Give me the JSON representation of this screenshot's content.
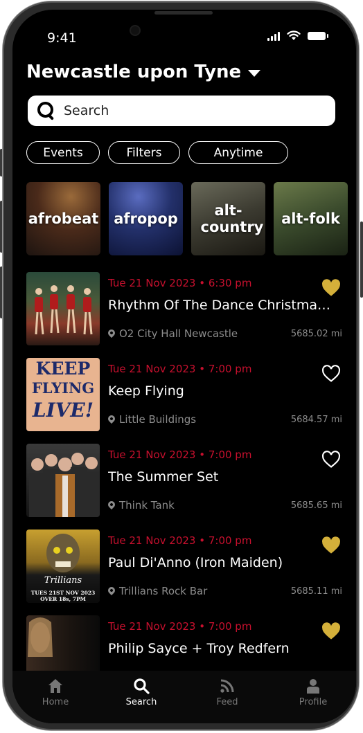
{
  "status": {
    "time": "9:41"
  },
  "location": {
    "city": "Newcastle upon Tyne"
  },
  "search": {
    "placeholder": "Search"
  },
  "filters": [
    "Events",
    "Filters",
    "Anytime"
  ],
  "genres": [
    "afrobeat",
    "afropop",
    "alt-country",
    "alt-folk"
  ],
  "events": [
    {
      "date": "Tue 21 Nov 2023 • 6:30 pm",
      "title": "Rhythm Of The Dance Christmas ...",
      "venue": "O2 City Hall Newcastle",
      "distance": "5685.02 mi",
      "favorited": true
    },
    {
      "date": "Tue 21 Nov 2023 • 7:00 pm",
      "title": "Keep Flying",
      "venue": "Little Buildings",
      "distance": "5684.57 mi",
      "favorited": false
    },
    {
      "date": "Tue 21 Nov 2023 • 7:00 pm",
      "title": "The Summer Set",
      "venue": "Think Tank",
      "distance": "5685.65 mi",
      "favorited": false
    },
    {
      "date": "Tue 21 Nov 2023 • 7:00 pm",
      "title": "Paul Di'Anno (Iron Maiden)",
      "venue": "Trillians Rock Bar",
      "distance": "5685.11 mi",
      "favorited": true
    },
    {
      "date": "Tue 21 Nov 2023 • 7:00 pm",
      "title": "Philip Sayce + Troy Redfern",
      "venue": "",
      "distance": "",
      "favorited": true
    }
  ],
  "tabs": [
    {
      "label": "Home",
      "icon": "home-icon",
      "active": false
    },
    {
      "label": "Search",
      "icon": "search-icon",
      "active": true
    },
    {
      "label": "Feed",
      "icon": "rss-feed-icon",
      "active": false
    },
    {
      "label": "Profile",
      "icon": "person-icon",
      "active": false
    }
  ],
  "colors": {
    "accent_date": "#c8102e",
    "heart_filled": "#d4b03a",
    "background": "#000000"
  },
  "thumbnails": {
    "event_1": "Keep Flying Live poster text",
    "event_1_text": [
      "KEEP",
      "FLYING",
      "LIVE!"
    ],
    "event_3_text": [
      "Trillians",
      "TUES 21ST NOV 2023",
      "OVER 18s, 7PM"
    ]
  }
}
